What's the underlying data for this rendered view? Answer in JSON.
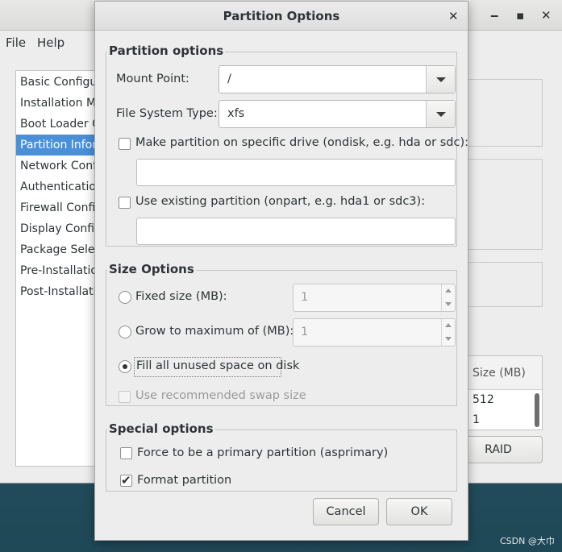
{
  "background_window": {
    "menu": [
      "File",
      "Help"
    ],
    "controls": {
      "minimize": "‒",
      "maximize": "▪",
      "close": "✕"
    },
    "sidebar_items": [
      {
        "label": "Basic Configuration",
        "selected": false
      },
      {
        "label": "Installation Method",
        "selected": false
      },
      {
        "label": "Boot Loader Options",
        "selected": false
      },
      {
        "label": "Partition Information",
        "selected": true
      },
      {
        "label": "Network Configuration",
        "selected": false
      },
      {
        "label": "Authentication",
        "selected": false
      },
      {
        "label": "Firewall Configuration",
        "selected": false
      },
      {
        "label": "Display Configuration",
        "selected": false
      },
      {
        "label": "Package Selection",
        "selected": false
      },
      {
        "label": "Pre-Installation Script",
        "selected": false
      },
      {
        "label": "Post-Installation Script",
        "selected": false
      }
    ],
    "table": {
      "header": "Size (MB)",
      "rows": [
        "512",
        "1"
      ]
    },
    "raid_button": "RAID"
  },
  "dialog": {
    "title": "Partition Options",
    "close_glyph": "✕",
    "partition_options": {
      "title": "Partition options",
      "mount_point_label": "Mount Point:",
      "mount_point_value": "/",
      "fs_type_label": "File System Type:",
      "fs_type_value": "xfs",
      "ondisk_label": "Make partition on specific drive (ondisk, e.g. hda or sdc):",
      "ondisk_checked": false,
      "ondisk_value": "",
      "onpart_label": "Use existing partition (onpart, e.g. hda1 or sdc3):",
      "onpart_checked": false,
      "onpart_value": ""
    },
    "size_options": {
      "title": "Size Options",
      "fixed_label": "Fixed size (MB):",
      "fixed_value": "1",
      "grow_label": "Grow to maximum of (MB):",
      "grow_value": "1",
      "fill_label": "Fill all unused space on disk",
      "selected": "fill",
      "swap_label": "Use recommended swap size",
      "swap_checked": false
    },
    "special_options": {
      "title": "Special options",
      "primary_label": "Force to be a primary partition (asprimary)",
      "primary_checked": false,
      "format_label": "Format partition",
      "format_checked": true
    },
    "buttons": {
      "cancel": "Cancel",
      "ok": "OK"
    }
  },
  "watermark": "CSDN @大巾",
  "colors": {
    "accent": "#4a90d9",
    "dialog_bg": "#ededed"
  }
}
